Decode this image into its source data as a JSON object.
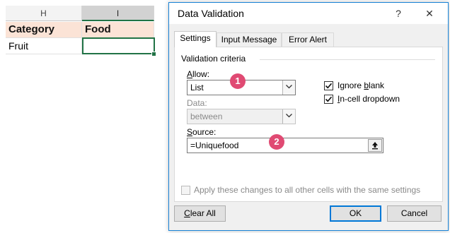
{
  "sheet": {
    "columns": [
      "H",
      "I"
    ],
    "rows": [
      [
        "Category",
        "Food"
      ],
      [
        "Fruit",
        ""
      ]
    ]
  },
  "dialog": {
    "title": "Data Validation",
    "help": "?",
    "close": "✕",
    "tabs": [
      "Settings",
      "Input Message",
      "Error Alert"
    ],
    "group_label": "Validation criteria",
    "allow": {
      "label_u": "A",
      "label_rest": "llow:",
      "value": "List"
    },
    "ignore_blank": {
      "label_pre": "Ignore ",
      "label_u": "b",
      "label_post": "lank",
      "checked": true
    },
    "in_cell": {
      "label_u": "I",
      "label_rest": "n-cell dropdown",
      "checked": true
    },
    "data": {
      "label": "Data:",
      "value": "between"
    },
    "source": {
      "label_u": "S",
      "label_rest": "ource:",
      "value": "=Uniquefood"
    },
    "badges": [
      "1",
      "2"
    ],
    "apply": {
      "label": "Apply these changes to all other cells with the same settings"
    },
    "buttons": {
      "clear_all_u": "C",
      "clear_all_rest": "lear All",
      "ok": "OK",
      "cancel": "Cancel"
    }
  },
  "colors": {
    "accent": "#0078d7",
    "excel_green": "#217346",
    "badge": "#e04a73",
    "header_fill": "#fbe3d6"
  }
}
